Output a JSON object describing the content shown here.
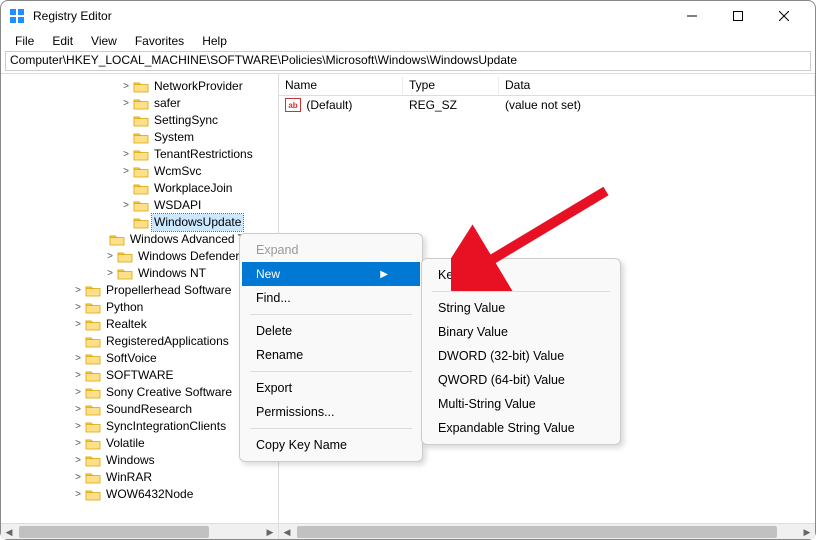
{
  "window": {
    "title": "Registry Editor"
  },
  "menu": {
    "file": "File",
    "edit": "Edit",
    "view": "View",
    "favorites": "Favorites",
    "help": "Help"
  },
  "address": "Computer\\HKEY_LOCAL_MACHINE\\SOFTWARE\\Policies\\Microsoft\\Windows\\WindowsUpdate",
  "tree": {
    "group1_indent": 116,
    "group1": [
      {
        "label": "NetworkProvider",
        "chev": ">"
      },
      {
        "label": "safer",
        "chev": ">"
      },
      {
        "label": "SettingSync",
        "chev": ""
      },
      {
        "label": "System",
        "chev": ""
      },
      {
        "label": "TenantRestrictions",
        "chev": ">"
      },
      {
        "label": "WcmSvc",
        "chev": ">"
      },
      {
        "label": "WorkplaceJoin",
        "chev": ""
      },
      {
        "label": "WSDAPI",
        "chev": ">"
      },
      {
        "label": "WindowsUpdate",
        "chev": "",
        "sel": true
      }
    ],
    "group2_indent": 100,
    "group2": [
      {
        "label": "Windows Advanced Threat Protection",
        "chev": ""
      },
      {
        "label": "Windows Defender",
        "chev": ">"
      },
      {
        "label": "Windows NT",
        "chev": ">"
      }
    ],
    "group3_indent": 68,
    "group3": [
      {
        "label": "Propellerhead Software",
        "chev": ">"
      },
      {
        "label": "Python",
        "chev": ">"
      },
      {
        "label": "Realtek",
        "chev": ">"
      },
      {
        "label": "RegisteredApplications",
        "chev": ""
      },
      {
        "label": "SoftVoice",
        "chev": ">"
      },
      {
        "label": "SOFTWARE",
        "chev": ">"
      },
      {
        "label": "Sony Creative Software",
        "chev": ">"
      },
      {
        "label": "SoundResearch",
        "chev": ">"
      },
      {
        "label": "SyncIntegrationClients",
        "chev": ">"
      },
      {
        "label": "Volatile",
        "chev": ">"
      },
      {
        "label": "Windows",
        "chev": ">"
      },
      {
        "label": "WinRAR",
        "chev": ">"
      },
      {
        "label": "WOW6432Node",
        "chev": ">"
      }
    ]
  },
  "list": {
    "headers": {
      "name": "Name",
      "type": "Type",
      "data": "Data"
    },
    "rows": [
      {
        "name": "(Default)",
        "type": "REG_SZ",
        "data": "(value not set)"
      }
    ]
  },
  "ctx1": {
    "expand": "Expand",
    "new": "New",
    "find": "Find...",
    "delete": "Delete",
    "rename": "Rename",
    "export": "Export",
    "permissions": "Permissions...",
    "copykey": "Copy Key Name"
  },
  "ctx2": {
    "key": "Key",
    "string": "String Value",
    "binary": "Binary Value",
    "dword": "DWORD (32-bit) Value",
    "qword": "QWORD (64-bit) Value",
    "multi": "Multi-String Value",
    "expand": "Expandable String Value"
  }
}
